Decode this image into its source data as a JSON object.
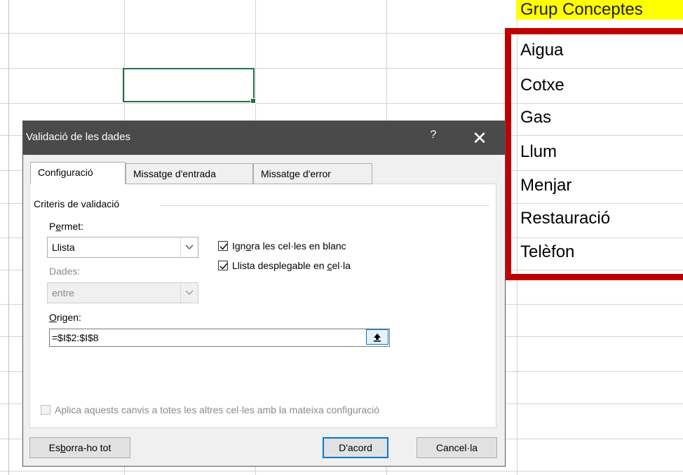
{
  "sheet": {
    "header": "Grup Conceptes",
    "items": [
      "Aigua",
      "Cotxe",
      "Gas",
      "Llum",
      "Menjar",
      "Restauració",
      "Telèfon"
    ]
  },
  "dialog": {
    "title": "Validació de les dades",
    "help_glyph": "?",
    "close_glyph": "✕",
    "tabs": [
      "Configuració",
      "Missatge d'entrada",
      "Missatge d'error"
    ],
    "group_label": "Criteris de validació",
    "permet_label_pre": "P",
    "permet_label_ul": "e",
    "permet_label_post": "rmet:",
    "permet_value": "Llista",
    "dades_label": "Dades:",
    "dades_value": "entre",
    "ignore_blank_pre": "Ign",
    "ignore_blank_ul": "o",
    "ignore_blank_post": "ra les cel·les en blanc",
    "dropdown_pre": "Llista desplegable en ",
    "dropdown_ul": "c",
    "dropdown_post": "el·la",
    "origen_label_ul": "O",
    "origen_label_post": "rigen:",
    "origen_value": "=$I$2:$I$8",
    "apply_all_label": "Aplica aquests canvis a totes les altres cel·les amb la mateixa configuració",
    "clear_pre": "Es",
    "clear_ul": "b",
    "clear_post": "orra-ho tot",
    "ok_label": "D'acord",
    "cancel_label": "Cancel·la"
  },
  "colors": {
    "highlight": "#c00000",
    "header_fill": "#ffff00",
    "selection": "#217346",
    "titlebar": "#4a4a4a"
  }
}
